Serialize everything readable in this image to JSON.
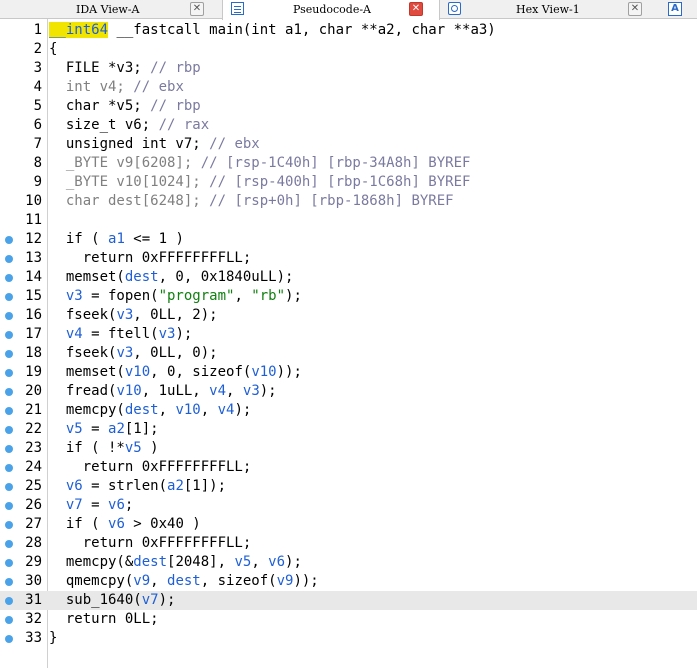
{
  "tabs": [
    {
      "label": "IDA View-A",
      "active": false,
      "icon": "graph-icon",
      "closable": true
    },
    {
      "label": "Pseudocode-A",
      "active": true,
      "icon": "pseudocode-icon",
      "closable": true
    },
    {
      "label": "Hex View-1",
      "active": false,
      "icon": "hex-icon",
      "closable": true
    },
    {
      "label": "A",
      "active": false,
      "icon": "structures-icon",
      "closable": false
    }
  ],
  "colors": {
    "variable": "#1f5fd6",
    "comment": "#7a7aa0",
    "string": "#108010",
    "highlight": "#f0e400",
    "breakpoint": "#4aa3e8",
    "current_line": "#e8e8e8"
  },
  "current_line": 31,
  "lines": [
    {
      "n": "1",
      "bp": false,
      "tokens": [
        [
          "h",
          "__int64"
        ],
        [
          "p",
          " __fastcall main(int a1, char **a2, char **a3)"
        ]
      ]
    },
    {
      "n": "2",
      "bp": false,
      "tokens": [
        [
          "p",
          "{"
        ]
      ]
    },
    {
      "n": "3",
      "bp": false,
      "tokens": [
        [
          "p",
          "  FILE *v3; "
        ],
        [
          "c",
          "// rbp"
        ]
      ]
    },
    {
      "n": "4",
      "bp": false,
      "tokens": [
        [
          "t",
          "  int v4; "
        ],
        [
          "c",
          "// ebx"
        ]
      ]
    },
    {
      "n": "5",
      "bp": false,
      "tokens": [
        [
          "p",
          "  char *v5; "
        ],
        [
          "c",
          "// rbp"
        ]
      ]
    },
    {
      "n": "6",
      "bp": false,
      "tokens": [
        [
          "p",
          "  size_t v6; "
        ],
        [
          "c",
          "// rax"
        ]
      ]
    },
    {
      "n": "7",
      "bp": false,
      "tokens": [
        [
          "p",
          "  unsigned int v7; "
        ],
        [
          "c",
          "// ebx"
        ]
      ]
    },
    {
      "n": "8",
      "bp": false,
      "tokens": [
        [
          "t",
          "  _BYTE v9[6208]; "
        ],
        [
          "c",
          "// [rsp-1C40h] [rbp-34A8h] BYREF"
        ]
      ]
    },
    {
      "n": "9",
      "bp": false,
      "tokens": [
        [
          "t",
          "  _BYTE v10[1024]; "
        ],
        [
          "c",
          "// [rsp-400h] [rbp-1C68h] BYREF"
        ]
      ]
    },
    {
      "n": "10",
      "bp": false,
      "tokens": [
        [
          "t",
          "  char dest[6248]; "
        ],
        [
          "c",
          "// [rsp+0h] [rbp-1868h] BYREF"
        ]
      ]
    },
    {
      "n": "11",
      "bp": false,
      "tokens": [
        [
          "p",
          ""
        ]
      ]
    },
    {
      "n": "12",
      "bp": true,
      "tokens": [
        [
          "p",
          "  if ( "
        ],
        [
          "v",
          "a1"
        ],
        [
          "p",
          " <= 1 )"
        ]
      ]
    },
    {
      "n": "13",
      "bp": true,
      "tokens": [
        [
          "p",
          "    return 0xFFFFFFFFLL;"
        ]
      ]
    },
    {
      "n": "14",
      "bp": true,
      "tokens": [
        [
          "p",
          "  memset("
        ],
        [
          "v",
          "dest"
        ],
        [
          "p",
          ", 0, 0x1840uLL);"
        ]
      ]
    },
    {
      "n": "15",
      "bp": true,
      "tokens": [
        [
          "v",
          "  v3"
        ],
        [
          "p",
          " = fopen("
        ],
        [
          "s",
          "\"program\""
        ],
        [
          "p",
          ", "
        ],
        [
          "s",
          "\"rb\""
        ],
        [
          "p",
          ");"
        ]
      ]
    },
    {
      "n": "16",
      "bp": true,
      "tokens": [
        [
          "p",
          "  fseek("
        ],
        [
          "v",
          "v3"
        ],
        [
          "p",
          ", 0LL, 2);"
        ]
      ]
    },
    {
      "n": "17",
      "bp": true,
      "tokens": [
        [
          "v",
          "  v4"
        ],
        [
          "p",
          " = ftell("
        ],
        [
          "v",
          "v3"
        ],
        [
          "p",
          ");"
        ]
      ]
    },
    {
      "n": "18",
      "bp": true,
      "tokens": [
        [
          "p",
          "  fseek("
        ],
        [
          "v",
          "v3"
        ],
        [
          "p",
          ", 0LL, 0);"
        ]
      ]
    },
    {
      "n": "19",
      "bp": true,
      "tokens": [
        [
          "p",
          "  memset("
        ],
        [
          "v",
          "v10"
        ],
        [
          "p",
          ", 0, sizeof("
        ],
        [
          "v",
          "v10"
        ],
        [
          "p",
          "));"
        ]
      ]
    },
    {
      "n": "20",
      "bp": true,
      "tokens": [
        [
          "p",
          "  fread("
        ],
        [
          "v",
          "v10"
        ],
        [
          "p",
          ", 1uLL, "
        ],
        [
          "v",
          "v4"
        ],
        [
          "p",
          ", "
        ],
        [
          "v",
          "v3"
        ],
        [
          "p",
          ");"
        ]
      ]
    },
    {
      "n": "21",
      "bp": true,
      "tokens": [
        [
          "p",
          "  memcpy("
        ],
        [
          "v",
          "dest"
        ],
        [
          "p",
          ", "
        ],
        [
          "v",
          "v10"
        ],
        [
          "p",
          ", "
        ],
        [
          "v",
          "v4"
        ],
        [
          "p",
          ");"
        ]
      ]
    },
    {
      "n": "22",
      "bp": true,
      "tokens": [
        [
          "v",
          "  v5"
        ],
        [
          "p",
          " = "
        ],
        [
          "v",
          "a2"
        ],
        [
          "p",
          "[1];"
        ]
      ]
    },
    {
      "n": "23",
      "bp": true,
      "tokens": [
        [
          "p",
          "  if ( !*"
        ],
        [
          "v",
          "v5"
        ],
        [
          "p",
          " )"
        ]
      ]
    },
    {
      "n": "24",
      "bp": true,
      "tokens": [
        [
          "p",
          "    return 0xFFFFFFFFLL;"
        ]
      ]
    },
    {
      "n": "25",
      "bp": true,
      "tokens": [
        [
          "v",
          "  v6"
        ],
        [
          "p",
          " = strlen("
        ],
        [
          "v",
          "a2"
        ],
        [
          "p",
          "[1]);"
        ]
      ]
    },
    {
      "n": "26",
      "bp": true,
      "tokens": [
        [
          "v",
          "  v7"
        ],
        [
          "p",
          " = "
        ],
        [
          "v",
          "v6"
        ],
        [
          "p",
          ";"
        ]
      ]
    },
    {
      "n": "27",
      "bp": true,
      "tokens": [
        [
          "p",
          "  if ( "
        ],
        [
          "v",
          "v6"
        ],
        [
          "p",
          " > 0x40 )"
        ]
      ]
    },
    {
      "n": "28",
      "bp": true,
      "tokens": [
        [
          "p",
          "    return 0xFFFFFFFFLL;"
        ]
      ]
    },
    {
      "n": "29",
      "bp": true,
      "tokens": [
        [
          "p",
          "  memcpy(&"
        ],
        [
          "v",
          "dest"
        ],
        [
          "p",
          "[2048], "
        ],
        [
          "v",
          "v5"
        ],
        [
          "p",
          ", "
        ],
        [
          "v",
          "v6"
        ],
        [
          "p",
          ");"
        ]
      ]
    },
    {
      "n": "30",
      "bp": true,
      "tokens": [
        [
          "p",
          "  qmemcpy("
        ],
        [
          "v",
          "v9"
        ],
        [
          "p",
          ", "
        ],
        [
          "v",
          "dest"
        ],
        [
          "p",
          ", sizeof("
        ],
        [
          "v",
          "v9"
        ],
        [
          "p",
          "));"
        ]
      ]
    },
    {
      "n": "31",
      "bp": true,
      "tokens": [
        [
          "p",
          "  sub_1640("
        ],
        [
          "v",
          "v7"
        ],
        [
          "p",
          ");"
        ]
      ]
    },
    {
      "n": "32",
      "bp": true,
      "tokens": [
        [
          "p",
          "  return 0LL;"
        ]
      ]
    },
    {
      "n": "33",
      "bp": true,
      "tokens": [
        [
          "p",
          "}"
        ]
      ]
    }
  ]
}
